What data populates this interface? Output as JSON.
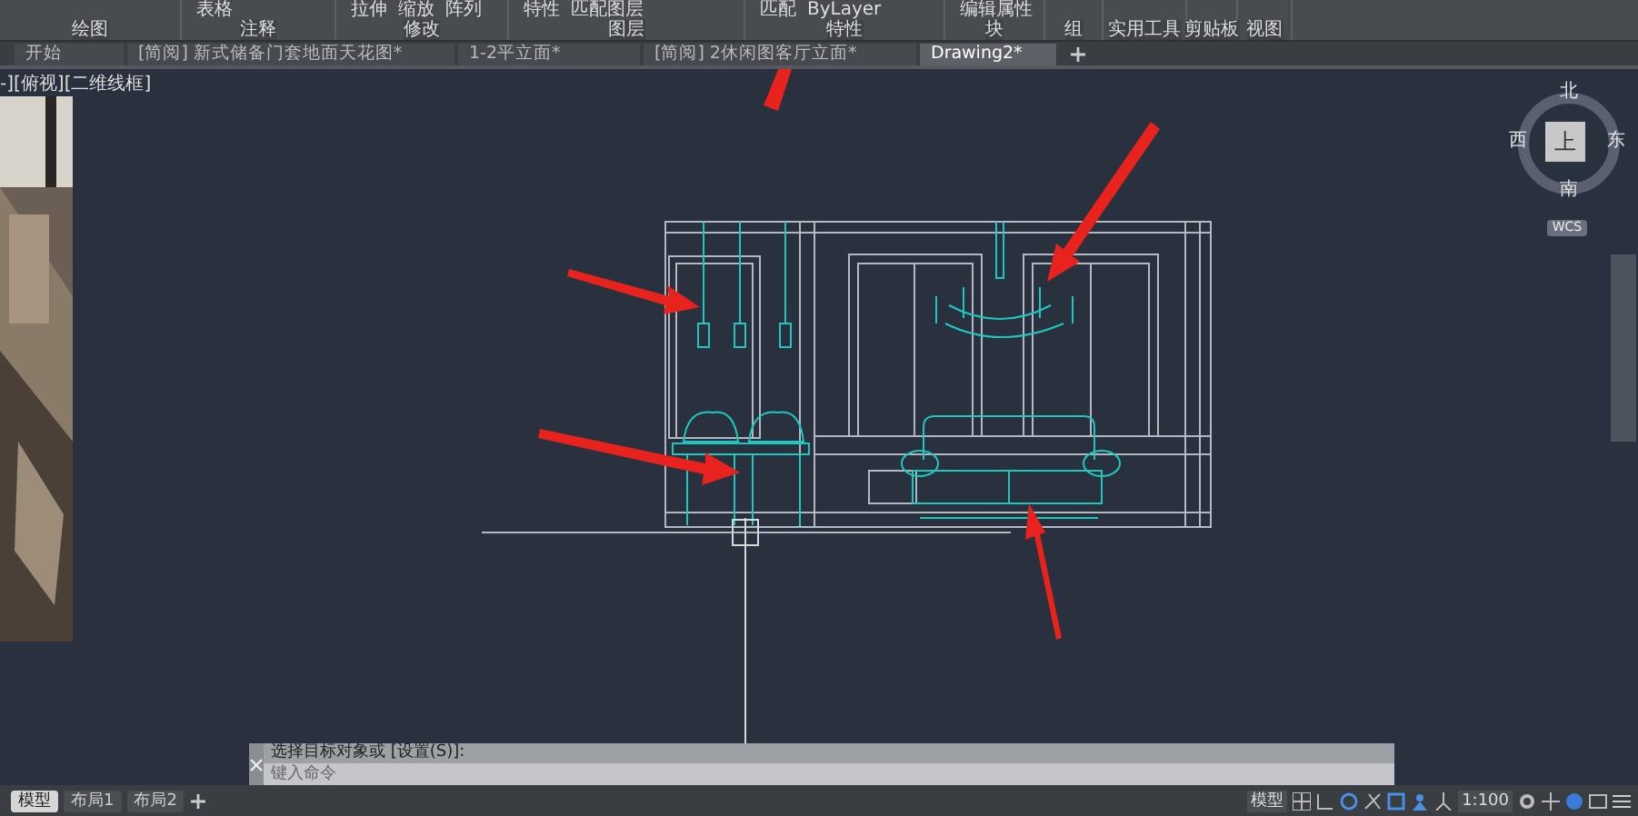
{
  "ribbon": {
    "panels": [
      {
        "label": "绘图"
      },
      {
        "label": "注释",
        "buttons": [
          "表格"
        ]
      },
      {
        "label": "修改",
        "buttons": [
          "拉伸",
          "缩放",
          "阵列"
        ]
      },
      {
        "label": "图层",
        "buttons": [
          "特性",
          "匹配图层"
        ]
      },
      {
        "label": "特性",
        "buttons": [
          "匹配",
          "ByLayer"
        ]
      },
      {
        "label": "块",
        "buttons": [
          "编辑属性"
        ]
      },
      {
        "label": "组"
      },
      {
        "label": "实用工具"
      },
      {
        "label": "剪贴板"
      },
      {
        "label": "视图"
      }
    ]
  },
  "file_tabs": [
    {
      "label": "开始",
      "selected": false
    },
    {
      "label": "[简阅] 新式储备门套地面天花图*",
      "selected": false
    },
    {
      "label": "1-2平立面*",
      "selected": false
    },
    {
      "label": "[简阅] 2休闲图客厅立面*",
      "selected": false
    },
    {
      "label": "Drawing2*",
      "selected": true
    }
  ],
  "viewport": {
    "label": "-][俯视][二维线框]"
  },
  "view_cube": {
    "north": "北",
    "south": "南",
    "east": "东",
    "west": "西",
    "top": "上",
    "wcs": "WCS"
  },
  "command_line": {
    "history": "选择目标对象或 [设置(S)]:",
    "placeholder": "键入命令"
  },
  "layout_tabs": [
    {
      "label": "模型",
      "selected": true
    },
    {
      "label": "布局1",
      "selected": false
    },
    {
      "label": "布局2",
      "selected": false
    }
  ],
  "status_bar": {
    "model": "模型",
    "scale": "1:100"
  }
}
